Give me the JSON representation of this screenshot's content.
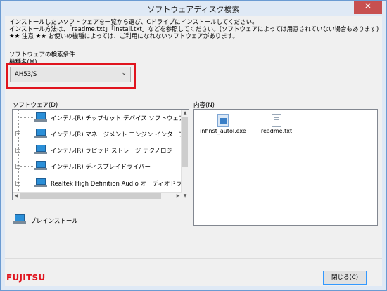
{
  "window": {
    "title": "ソフトウェアディスク検索",
    "close_glyph": "✕"
  },
  "instructions": [
    "インストールしたいソフトウェアを一覧から選び、Cドライブにインストールしてください。",
    "インストール方法は、「readme.txt」「install.txt」などを参照してください。(ソフトウェアによっては用意されていない場合もあります)",
    "★★ 注意 ★★ お使いの機種によっては、ご利用になれないソフトウェアがあります。"
  ],
  "search_conditions": {
    "group_label": "ソフトウェアの検索条件",
    "model_label": "機種名(M)",
    "model_value": "AH53/S",
    "dropdown_icon": "chevron-down-icon"
  },
  "software": {
    "label": "ソフトウェア(D)",
    "items": [
      {
        "label": "インテル(R) チップセット デバイス ソフトウェア",
        "icon": "laptop-icon"
      },
      {
        "label": "インテル(R) マネージメント エンジン インターフェイ",
        "icon": "laptop-icon"
      },
      {
        "label": "インテル(R) ラピッド ストレージ テクノロジー",
        "icon": "laptop-icon"
      },
      {
        "label": "インテル(R) ディスプレイドライバー",
        "icon": "laptop-icon"
      },
      {
        "label": "Realtek High Definition Audio オーディオドライバ",
        "icon": "laptop-icon"
      }
    ]
  },
  "contents": {
    "label": "内容(N)",
    "files": [
      {
        "name": "infinst_autol.exe",
        "icon": "exe-file-icon"
      },
      {
        "name": "readme.txt",
        "icon": "text-file-icon"
      }
    ]
  },
  "preinstall": {
    "label": "プレインストール",
    "icon": "laptop-icon"
  },
  "footer": {
    "logo": "FUJITSU",
    "close_button": "閉じる(C)"
  },
  "colors": {
    "highlight": "#e0141e",
    "logo": "#e0141e",
    "window_frame": "#dfe9f5",
    "close_button": "#c75050"
  }
}
